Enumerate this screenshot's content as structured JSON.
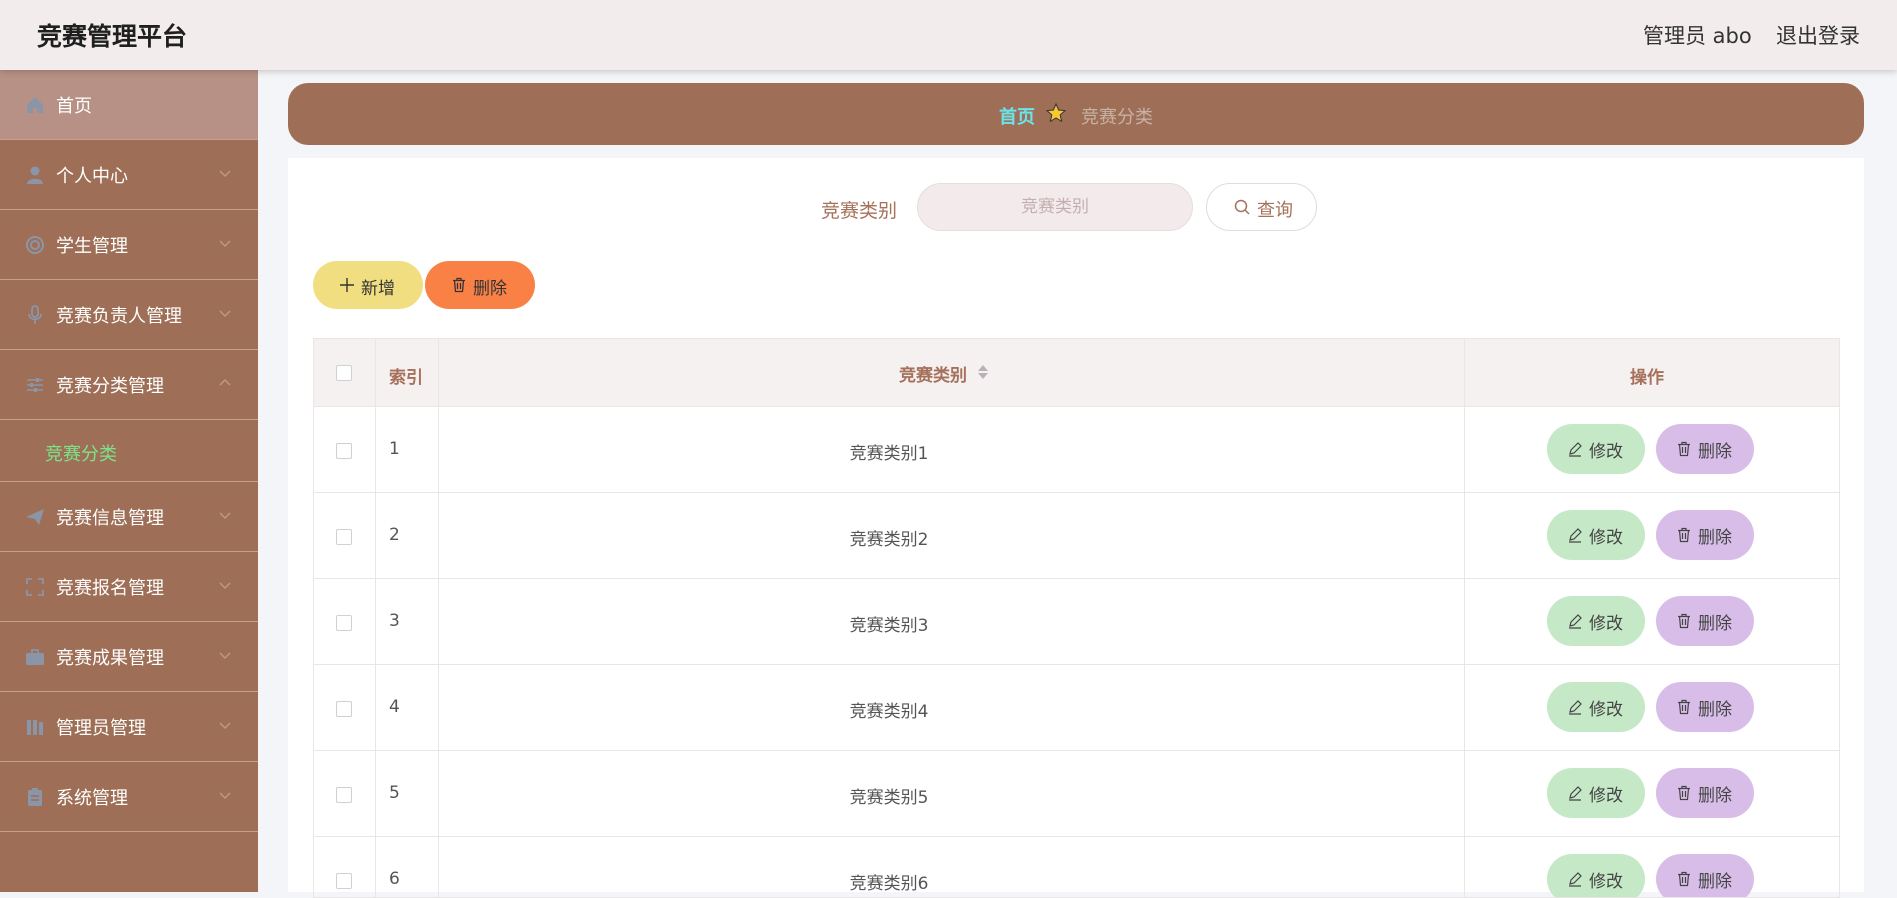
{
  "header": {
    "title": "竞赛管理平台",
    "user": "管理员 abo",
    "logout": "退出登录"
  },
  "sidebar": {
    "items": [
      {
        "label": "首页",
        "icon": "home-icon"
      },
      {
        "label": "个人中心",
        "icon": "user-icon"
      },
      {
        "label": "学生管理",
        "icon": "lifebuoy-icon"
      },
      {
        "label": "竞赛负责人管理",
        "icon": "microphone-icon"
      },
      {
        "label": "竞赛分类管理",
        "icon": "sliders-icon",
        "expanded": true
      },
      {
        "label": "竞赛信息管理",
        "icon": "paper-plane-icon"
      },
      {
        "label": "竞赛报名管理",
        "icon": "fullscreen-icon"
      },
      {
        "label": "竞赛成果管理",
        "icon": "briefcase-icon"
      },
      {
        "label": "管理员管理",
        "icon": "books-icon"
      },
      {
        "label": "系统管理",
        "icon": "clipboard-icon"
      }
    ],
    "submenu": {
      "label": "竞赛分类"
    }
  },
  "breadcrumb": {
    "home": "首页",
    "current": "竞赛分类"
  },
  "search": {
    "label": "竞赛类别",
    "placeholder": "竞赛类别",
    "value": "",
    "button": "查询"
  },
  "actions": {
    "add": "新增",
    "delete": "删除"
  },
  "table": {
    "headers": {
      "index": "索引",
      "category": "竞赛类别",
      "operation": "操作"
    },
    "edit_label": "修改",
    "delete_label": "删除",
    "rows": [
      {
        "index": "1",
        "category": "竞赛类别1"
      },
      {
        "index": "2",
        "category": "竞赛类别2"
      },
      {
        "index": "3",
        "category": "竞赛类别3"
      },
      {
        "index": "4",
        "category": "竞赛类别4"
      },
      {
        "index": "5",
        "category": "竞赛类别5"
      },
      {
        "index": "6",
        "category": "竞赛类别6"
      }
    ]
  },
  "colors": {
    "sidebar_bg": "#9e6f56",
    "sidebar_active": "#b79185",
    "submenu_active_text": "#7de38a",
    "breadcrumb_home": "#6be3ea",
    "add_button": "#f0de80",
    "delete_button": "#f98146",
    "edit_row_button": "#c5e8c7",
    "delete_row_button": "#d8bde8"
  }
}
